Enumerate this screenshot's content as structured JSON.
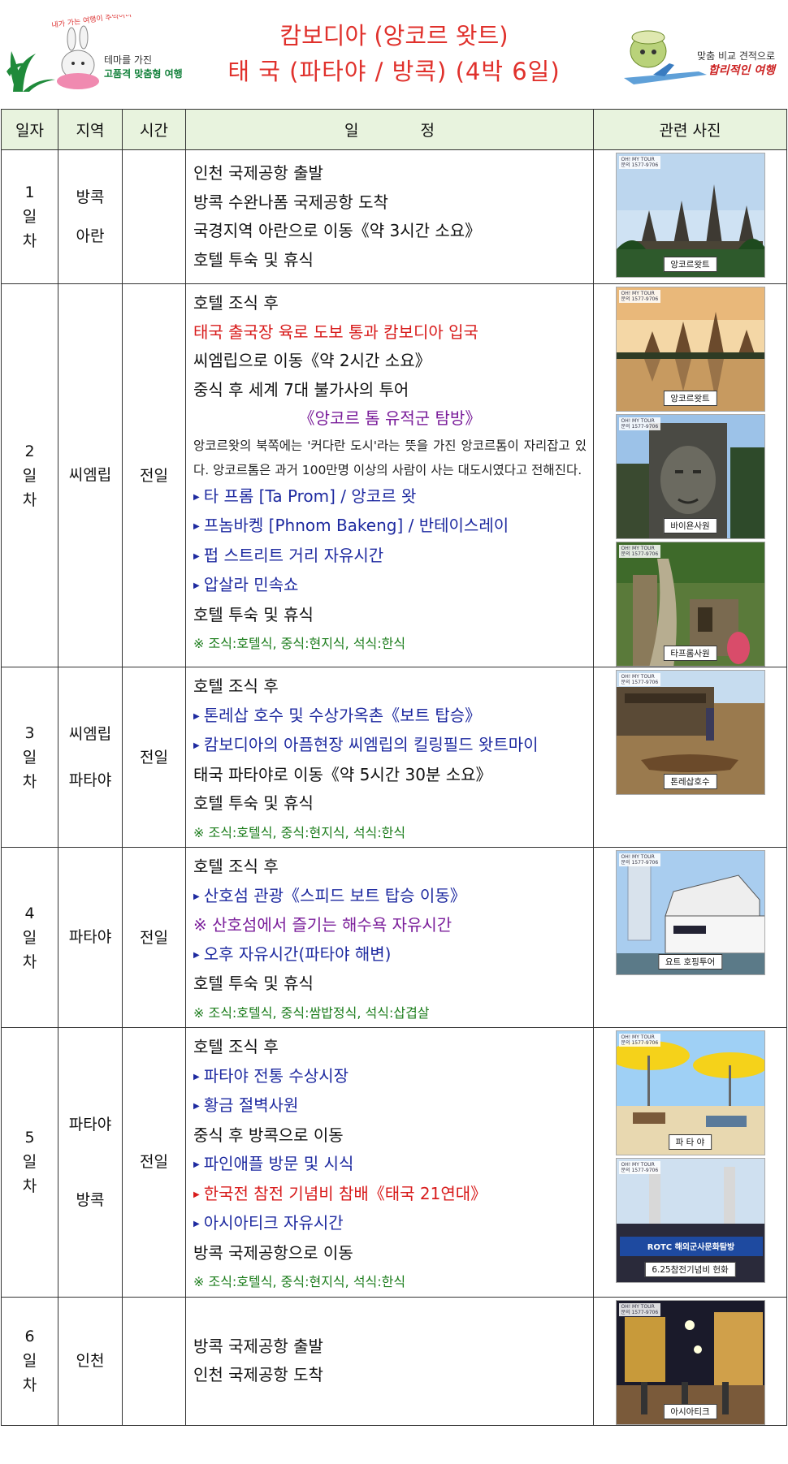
{
  "header": {
    "title_line1": "캄보디아 (앙코르 왓트)",
    "title_line2": "태 국 (파타야 / 방콕) (4박 6일)",
    "left_logo": {
      "script": "내가 가는 여행이 추억이다",
      "tagline_small": "테마를 가진",
      "tagline_strong": "고품격 맞춤형 여행"
    },
    "right_logo": {
      "tagline_small": "맞춤 비교 견적으로",
      "tagline_strong": "합리적인 여행"
    }
  },
  "table": {
    "headers": [
      "일자",
      "지역",
      "시간",
      "일　　　　정",
      "관련 사진"
    ],
    "days": [
      {
        "day": [
          "1",
          "일",
          "차"
        ],
        "regions": [
          "방콕",
          "아란"
        ],
        "time": "",
        "lines": [
          {
            "text": "인천 국제공항 출발",
            "style": "normal"
          },
          {
            "text": "방콕 수완나폼 국제공항 도착",
            "style": "normal"
          },
          {
            "text": "국경지역 아란으로 이동《약 3시간 소요》",
            "style": "normal"
          },
          {
            "text": "호텔 투숙 및 휴식",
            "style": "normal"
          }
        ]
      },
      {
        "day": [
          "2",
          "일",
          "차"
        ],
        "regions": [
          "씨엠립"
        ],
        "time": "전일",
        "lines": [
          {
            "text": "호텔 조식 후",
            "style": "normal"
          },
          {
            "text": "태국 출국장 육로 도보 통과 캄보디아 입국",
            "style": "red"
          },
          {
            "text": "씨엠립으로 이동《약 2시간 소요》",
            "style": "normal"
          },
          {
            "text": "중식 후 세계 7대 불가사의 투어",
            "style": "normal"
          },
          {
            "text": "《앙코르 톰 유적군 탐방》",
            "style": "purple-center"
          }
        ],
        "paragraph": "앙코르왓의 북쪽에는 '커다란 도시'라는 뜻을 가진 앙코르톰이 자리잡고 있다. 앙코르톰은 과거 100만명 이상의 사람이 사는 대도시였다고 전해진다.",
        "lines_after": [
          {
            "text": "타 프롬 [Ta Prom] / 앙코르 왓",
            "style": "blue-bullet"
          },
          {
            "text": "프놈바켕 [Phnom Bakeng] / 반테이스레이",
            "style": "blue-bullet"
          },
          {
            "text": "펍 스트리트 거리 자유시간",
            "style": "blue-bullet"
          },
          {
            "text": "압살라 민속쇼",
            "style": "blue-bullet"
          },
          {
            "text": "호텔 투숙 및 휴식",
            "style": "normal"
          },
          {
            "text": "※ 조식:호텔식, 중식:현지식, 석식:한식",
            "style": "green"
          }
        ]
      },
      {
        "day": [
          "3",
          "일",
          "차"
        ],
        "regions": [
          "씨엠립",
          "파타야"
        ],
        "time": "전일",
        "lines": [
          {
            "text": "호텔 조식 후",
            "style": "normal"
          },
          {
            "text": "톤레삽 호수 및 수상가옥촌《보트 탑승》",
            "style": "blue-bullet"
          },
          {
            "text": "캄보디아의 아픔현장 씨엠립의 킬링필드 왓트마이",
            "style": "blue-bullet"
          },
          {
            "text": "태국 파타야로 이동《약 5시간 30분 소요》",
            "style": "normal"
          },
          {
            "text": "호텔 투숙 및 휴식",
            "style": "normal"
          },
          {
            "text": "※ 조식:호텔식, 중식:현지식, 석식:한식",
            "style": "green"
          }
        ]
      },
      {
        "day": [
          "4",
          "일",
          "차"
        ],
        "regions": [
          "파타야"
        ],
        "time": "전일",
        "lines": [
          {
            "text": "호텔 조식 후",
            "style": "normal"
          },
          {
            "text": "산호섬 관광《스피드 보트 탑승 이동》",
            "style": "blue-bullet"
          },
          {
            "text": "※ 산호섬에서 즐기는 해수욕 자유시간",
            "style": "purple"
          },
          {
            "text": "오후 자유시간(파타야 해변)",
            "style": "blue-bullet"
          },
          {
            "text": "호텔 투숙 및 휴식",
            "style": "normal"
          },
          {
            "text": "※ 조식:호텔식, 중식:쌈밥정식, 석식:삽겹살",
            "style": "green"
          }
        ]
      },
      {
        "day": [
          "5",
          "일",
          "차"
        ],
        "regions": [
          "파타야",
          "방콕"
        ],
        "time": "전일",
        "lines": [
          {
            "text": "호텔 조식 후",
            "style": "normal"
          },
          {
            "text": "파타야 전통 수상시장",
            "style": "blue-bullet"
          },
          {
            "text": "황금 절벽사원",
            "style": "blue-bullet"
          },
          {
            "text": "중식 후 방콕으로 이동",
            "style": "normal"
          },
          {
            "text": "파인애플 방문 및 시식",
            "style": "blue-bullet"
          },
          {
            "text": "한국전 참전 기념비 참배《태국 21연대》",
            "style": "red-bullet"
          },
          {
            "text": "아시아티크 자유시간",
            "style": "blue-bullet"
          },
          {
            "text": "방콕 국제공항으로 이동",
            "style": "normal"
          },
          {
            "text": "※ 조식:호텔식, 중식:현지식, 석식:한식",
            "style": "green"
          }
        ]
      },
      {
        "day": [
          "6",
          "일",
          "차"
        ],
        "regions": [
          "인천"
        ],
        "time": "",
        "lines": [
          {
            "text": "방콕 국제공항 출발",
            "style": "normal"
          },
          {
            "text": "인천 국제공항 도착",
            "style": "normal"
          }
        ]
      }
    ]
  },
  "photos": [
    {
      "label": "앙코르왓트",
      "tag": "OH! MY TOUR\n문의 1577-9706",
      "theme": "temple"
    },
    {
      "label": "앙코르왓트",
      "tag": "OH! MY TOUR\n문의 1577-9706",
      "theme": "temple-sunset"
    },
    {
      "label": "바이욘사원",
      "tag": "OH! MY TOUR\n문의 1577-9706",
      "theme": "stone-face"
    },
    {
      "label": "타프롬사원",
      "tag": "OH! MY TOUR\n문의 1577-9706",
      "theme": "jungle-ruin"
    },
    {
      "label": "톤레삽호수",
      "tag": "OH! MY TOUR\n문의 1577-9706",
      "theme": "lake"
    },
    {
      "label": "요트 호핑투어",
      "tag": "OH! MY TOUR\n문의 1577-9706",
      "theme": "yacht"
    },
    {
      "label": "파 타 야",
      "tag": "OH! MY TOUR\n문의 1577-9706",
      "theme": "beach"
    },
    {
      "label": "6.25참전기념비 헌화",
      "tag": "OH! MY TOUR\n문의 1577-9706",
      "theme": "memorial",
      "banner": "ROTC 해외군사문화탐방"
    },
    {
      "label": "아시아티크",
      "tag": "OH! MY TOUR\n문의 1577-9706",
      "theme": "night-market"
    }
  ],
  "colors": {
    "title": "#e0312c",
    "header_bg": "#e8f3de",
    "red": "#d81b1b",
    "blue": "#1e2aa0",
    "purple": "#7a1d9a",
    "green": "#1c7d1c"
  }
}
